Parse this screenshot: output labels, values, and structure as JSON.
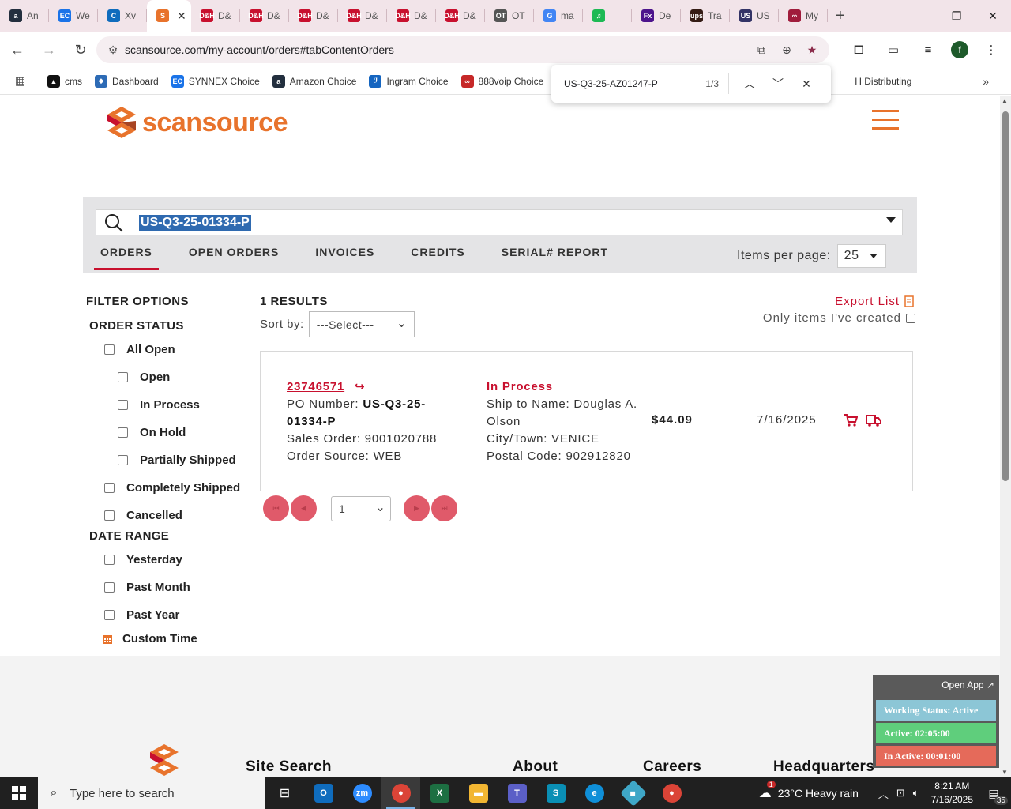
{
  "browser": {
    "tabs": [
      {
        "title": "An",
        "icon_text": "a",
        "icon_color": "#232f3e"
      },
      {
        "title": "We",
        "icon_text": "EC",
        "icon_color": "#1a73e8"
      },
      {
        "title": "Xv",
        "icon_text": "C",
        "icon_color": "#0f6cbd"
      },
      {
        "title": "",
        "icon_text": "S",
        "icon_color": "#e8732c",
        "active": true
      },
      {
        "title": "D&",
        "icon_text": "D&H",
        "icon_color": "#c8102e"
      },
      {
        "title": "D&",
        "icon_text": "D&H",
        "icon_color": "#c8102e"
      },
      {
        "title": "D&",
        "icon_text": "D&H",
        "icon_color": "#c8102e"
      },
      {
        "title": "D&",
        "icon_text": "D&H",
        "icon_color": "#c8102e"
      },
      {
        "title": "D&",
        "icon_text": "D&H",
        "icon_color": "#c8102e"
      },
      {
        "title": "D&",
        "icon_text": "D&H",
        "icon_color": "#c8102e"
      },
      {
        "title": "OT",
        "icon_text": "OT",
        "icon_color": "#555555"
      },
      {
        "title": "ma",
        "icon_text": "G",
        "icon_color": "#4285f4"
      },
      {
        "title": "",
        "icon_text": "♫",
        "icon_color": "#1db954"
      },
      {
        "title": "De",
        "icon_text": "Fx",
        "icon_color": "#4d148c"
      },
      {
        "title": "Tra",
        "icon_text": "ups",
        "icon_color": "#351c15"
      },
      {
        "title": "US",
        "icon_text": "US",
        "icon_color": "#333366"
      },
      {
        "title": "My",
        "icon_text": "∞",
        "icon_color": "#a01c3c"
      }
    ],
    "url": "scansource.com/my-account/orders#tabContentOrders",
    "profile_initial": "f",
    "bookmarks": [
      {
        "label": "cms",
        "icon_color": "#111111",
        "icon_text": "▲"
      },
      {
        "label": "Dashboard",
        "icon_color": "#2d6bb5",
        "icon_text": "◆"
      },
      {
        "label": "SYNNEX Choice",
        "icon_color": "#1a73e8",
        "icon_text": "EC"
      },
      {
        "label": "Amazon Choice",
        "icon_color": "#232f3e",
        "icon_text": "a"
      },
      {
        "label": "Ingram Choice",
        "icon_color": "#1565c0",
        "icon_text": "ℐ"
      },
      {
        "label": "888voip Choice",
        "icon_color": "#c62828",
        "icon_text": "∞"
      },
      {
        "label": "H Distributing",
        "icon_color": "#ffffff",
        "icon_text": ""
      }
    ]
  },
  "findbar": {
    "query": "US-Q3-25-AZ01247-P",
    "count": "1/3"
  },
  "site": {
    "brand": "scansource",
    "search_value": "US-Q3-25-01334-P",
    "tabs": [
      "ORDERS",
      "OPEN ORDERS",
      "INVOICES",
      "CREDITS",
      "SERIAL# REPORT"
    ],
    "items_per_page_label": "Items per page:",
    "items_per_page_value": "25",
    "filter": {
      "title": "FILTER OPTIONS",
      "order_status_label": "ORDER STATUS",
      "order_status": [
        {
          "label": "All Open",
          "indent": false
        },
        {
          "label": "Open",
          "indent": true
        },
        {
          "label": "In Process",
          "indent": true
        },
        {
          "label": "On Hold",
          "indent": true
        },
        {
          "label": "Partially Shipped",
          "indent": true
        },
        {
          "label": "Completely Shipped",
          "indent": false
        },
        {
          "label": "Cancelled",
          "indent": false
        }
      ],
      "date_range_label": "DATE RANGE",
      "date_range": [
        "Yesterday",
        "Past Month",
        "Past Year"
      ],
      "custom_time": "Custom Time"
    },
    "results": {
      "count": "1 RESULTS",
      "sort_label": "Sort by:",
      "sort_value": "---Select---",
      "export": "Export List",
      "only_mine": "Only items I've created"
    },
    "order": {
      "number": "23746571",
      "po_label": "PO Number:",
      "po_value": "US-Q3-25-01334-P",
      "po_value_line1": "US-Q3-25-",
      "po_value_line2": "01334-P",
      "sales_order": "Sales Order: 9001020788",
      "order_source": "Order Source: WEB",
      "status": "In Process",
      "ship_to": "Ship to Name: Douglas A. Olson",
      "city": "City/Town: VENICE",
      "postal": "Postal Code: 902912820",
      "amount": "$44.09",
      "date": "7/16/2025"
    },
    "pager": {
      "page": "1"
    },
    "footer": [
      "Site Search",
      "About",
      "Careers",
      "Headquarters"
    ]
  },
  "widget": {
    "open_app": "Open App ↗",
    "working_status": "Working Status: Active",
    "active": "Active: 02:05:00",
    "inactive": "In Active: 00:01:00"
  },
  "taskbar": {
    "search_placeholder": "Type here to search",
    "weather": "23°C  Heavy rain",
    "time": "8:21 AM",
    "date": "7/16/2025",
    "notifications": "35",
    "weather_badge": "1"
  }
}
